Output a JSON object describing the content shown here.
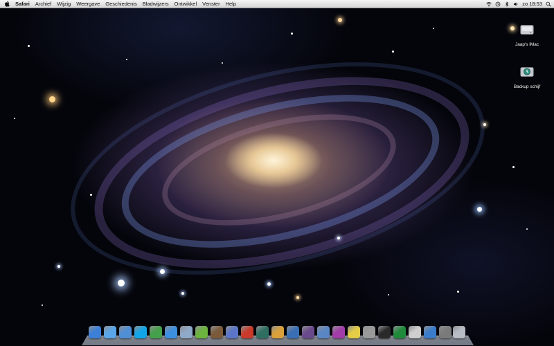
{
  "menubar": {
    "app_name": "Safari",
    "items": [
      "Archief",
      "Wijzig",
      "Weergave",
      "Geschiedenis",
      "Bladwijzers",
      "Ontwikkel",
      "Venster",
      "Help"
    ],
    "clock": "zo 18:53",
    "status_icons": [
      "wifi-icon",
      "time-machine-icon",
      "bluetooth-icon",
      "volume-icon",
      "spotlight-icon"
    ]
  },
  "desktop_icons": [
    {
      "label": "Jaap's iMac",
      "icon": "hard-drive-icon"
    },
    {
      "label": "Backup schijf",
      "icon": "time-machine-drive-icon"
    }
  ],
  "dock": {
    "icons": [
      {
        "name": "finder",
        "color": "#3b7fd9"
      },
      {
        "name": "safari",
        "color": "#5aa6e8"
      },
      {
        "name": "app-store",
        "color": "#4f8fd6"
      },
      {
        "name": "skype",
        "color": "#12a5e8"
      },
      {
        "name": "messenger",
        "color": "#44a04a"
      },
      {
        "name": "ichat",
        "color": "#3d8fe0"
      },
      {
        "name": "mail",
        "color": "#8fa9c9"
      },
      {
        "name": "spotify",
        "color": "#6cb33f"
      },
      {
        "name": "iphoto",
        "color": "#7a5a3a"
      },
      {
        "name": "itunes",
        "color": "#5b76c8"
      },
      {
        "name": "flashcard",
        "color": "#c93a2a"
      },
      {
        "name": "time-machine",
        "color": "#2f6f62"
      },
      {
        "name": "preview",
        "color": "#d9a03b"
      },
      {
        "name": "google-earth",
        "color": "#3a6fb5"
      },
      {
        "name": "photo-booth",
        "color": "#6a4a8c"
      },
      {
        "name": "downloads-folder",
        "color": "#5a86c4"
      },
      {
        "name": "front-row",
        "color": "#a23ca8"
      },
      {
        "name": "stickies",
        "color": "#e3cd46"
      },
      {
        "name": "utilities",
        "color": "#9a9a9a"
      },
      {
        "name": "dvd-player",
        "color": "#2a2a2a"
      },
      {
        "name": "activity-monitor",
        "color": "#1f8a3a"
      },
      {
        "name": "textedit",
        "color": "#cfcfcf"
      },
      {
        "name": "network",
        "color": "#3a7cc9"
      },
      {
        "name": "documents-stack",
        "color": "#7a7a7a"
      },
      {
        "name": "trash",
        "color": "#b8bcc4"
      }
    ]
  }
}
